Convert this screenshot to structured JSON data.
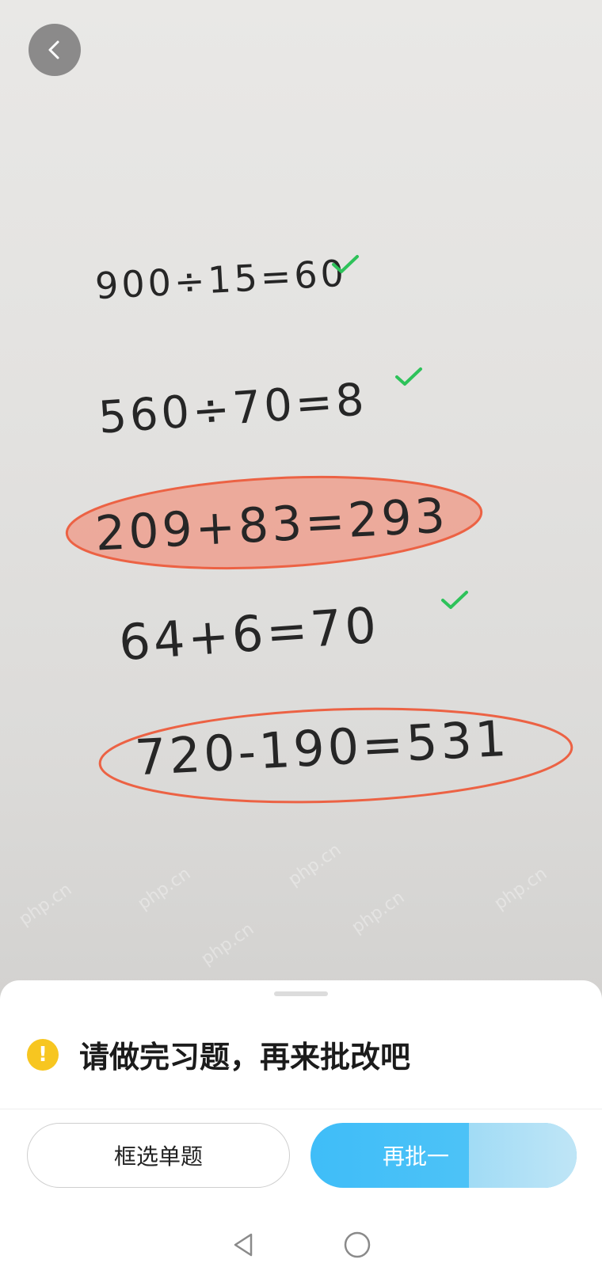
{
  "equations": [
    {
      "text": "900÷15=60",
      "mark": "correct"
    },
    {
      "text": "560÷70=8",
      "mark": "correct"
    },
    {
      "text": "209+83=293",
      "mark": "wrong"
    },
    {
      "text": "64+6=70",
      "mark": "correct"
    },
    {
      "text": "720-190=531",
      "mark": "wrong"
    }
  ],
  "watermark": "php.cn",
  "colors": {
    "correct_check": "#2ec25a",
    "wrong_circle": "#ec6244",
    "wrong_fill": "#eda08f",
    "warning": "#f7c620",
    "primary_button": "#3fbdf8"
  },
  "sheet": {
    "message": "请做完习题，再来批改吧",
    "buttons": {
      "select_question": "框选单题",
      "regrade": "再批一"
    }
  },
  "icons": {
    "back": "chevron-left-icon",
    "warning": "exclamation-circle-icon",
    "nav_back": "triangle-back-icon",
    "nav_home": "circle-home-icon"
  }
}
